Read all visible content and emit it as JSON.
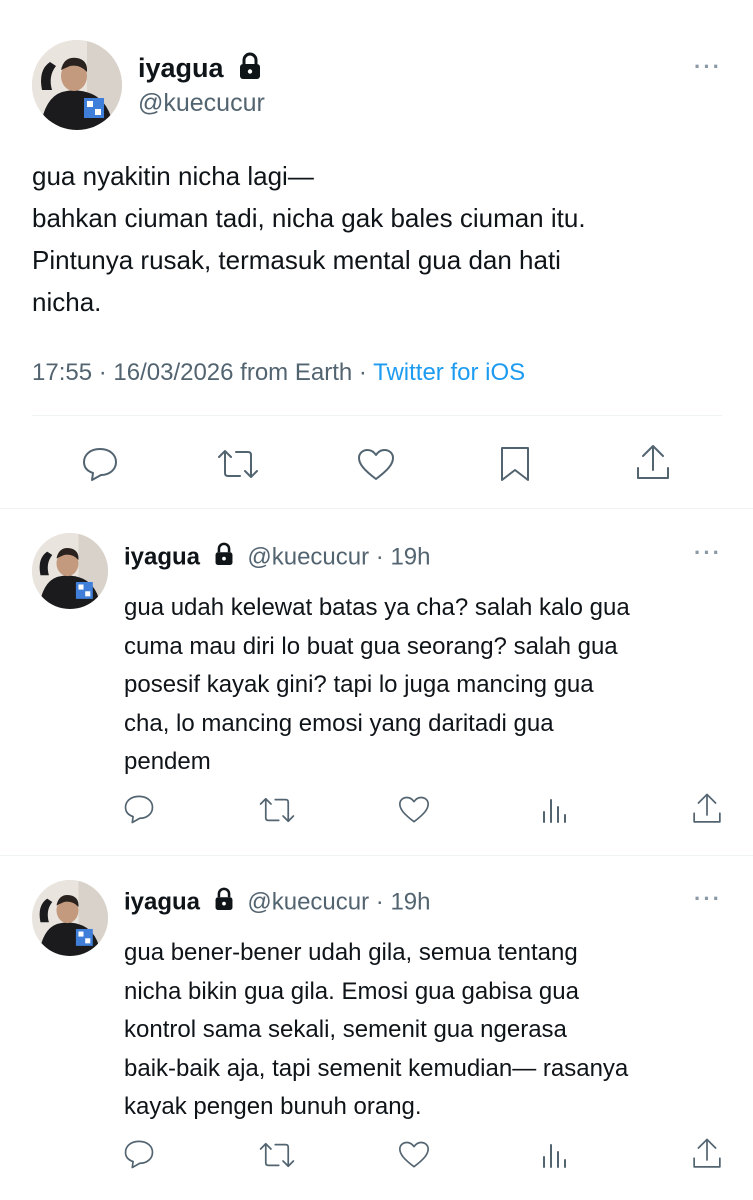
{
  "main_tweet": {
    "display_name": "iyagua",
    "handle": "@kuecucur",
    "text": "gua nyakitin nicha lagi—\nbahkan ciuman tadi, nicha gak bales ciuman itu.\nPintunya rusak, termasuk mental gua dan hati\nnicha.",
    "timestamp": "17:55 · 16/03/2026 from Earth · ",
    "source": "Twitter for iOS",
    "more": "···"
  },
  "replies": [
    {
      "display_name": "iyagua",
      "handle": "@kuecucur",
      "time": "· 19h",
      "text": "gua udah kelewat batas ya cha? salah kalo gua\ncuma mau diri lo buat gua seorang? salah gua\nposesif kayak gini? tapi lo juga mancing gua\ncha, lo mancing emosi yang daritadi gua\npendem",
      "more": "···"
    },
    {
      "display_name": "iyagua",
      "handle": "@kuecucur",
      "time": "· 19h",
      "text": "gua bener-bener udah gila, semua tentang\nnicha bikin gua gila. Emosi gua gabisa gua\nkontrol sama sekali, semenit gua ngerasa\nbaik-baik aja, tapi semenit kemudian— rasanya\nkayak pengen bunuh orang.",
      "more": "···"
    }
  ],
  "icons": [
    "reply-icon",
    "retweet-icon",
    "like-icon",
    "bookmark-icon",
    "share-icon",
    "views-icon",
    "lock-icon",
    "more-icon"
  ],
  "colors": {
    "link": "#1d9bf0",
    "muted": "#536471",
    "divider": "#eff3f4"
  }
}
